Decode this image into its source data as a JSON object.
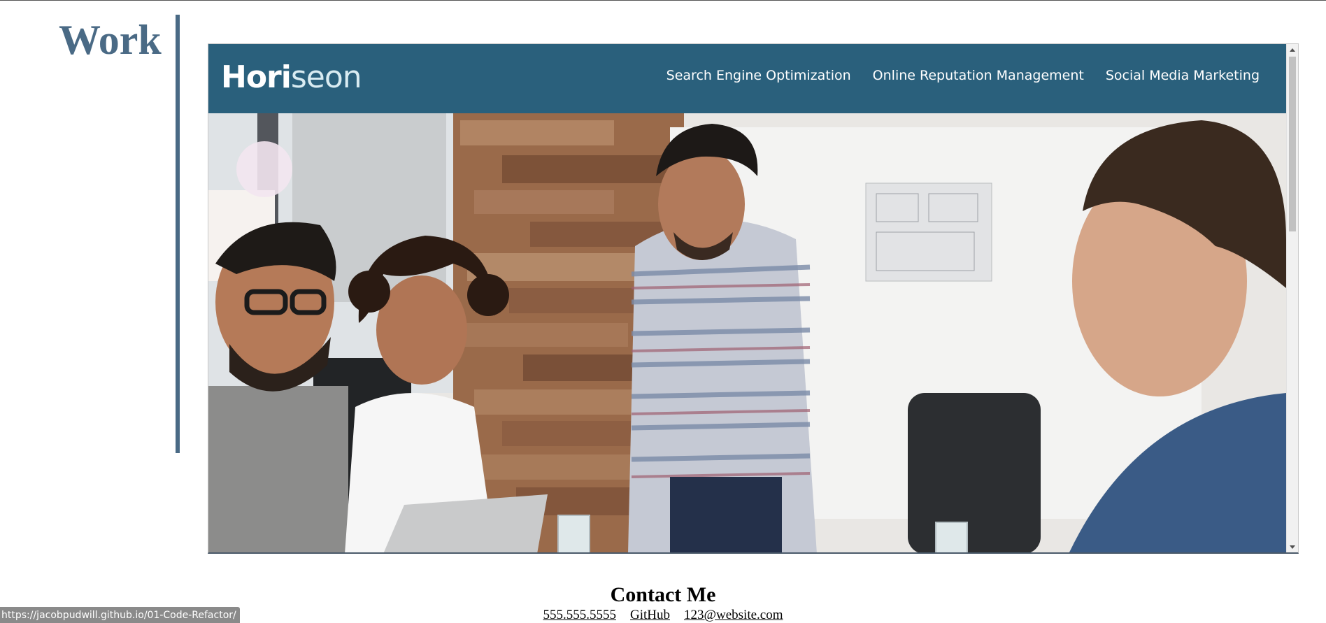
{
  "section": {
    "title": "Work"
  },
  "embed": {
    "logo_part1": "Hori",
    "logo_part2": "seon",
    "nav": [
      {
        "label": "Search Engine Optimization"
      },
      {
        "label": "Online Reputation Management"
      },
      {
        "label": "Social Media Marketing"
      }
    ],
    "hero_alt": "team working together at a meeting table"
  },
  "contact": {
    "title": "Contact Me",
    "phone": "555.555.5555",
    "github": "GitHub",
    "email": "123@website.com"
  },
  "status_bar": {
    "url": "https://jacobpudwill.github.io/01-Code-Refactor/"
  },
  "colors": {
    "accent": "#4a6a85",
    "header_bg": "#2a607c"
  }
}
